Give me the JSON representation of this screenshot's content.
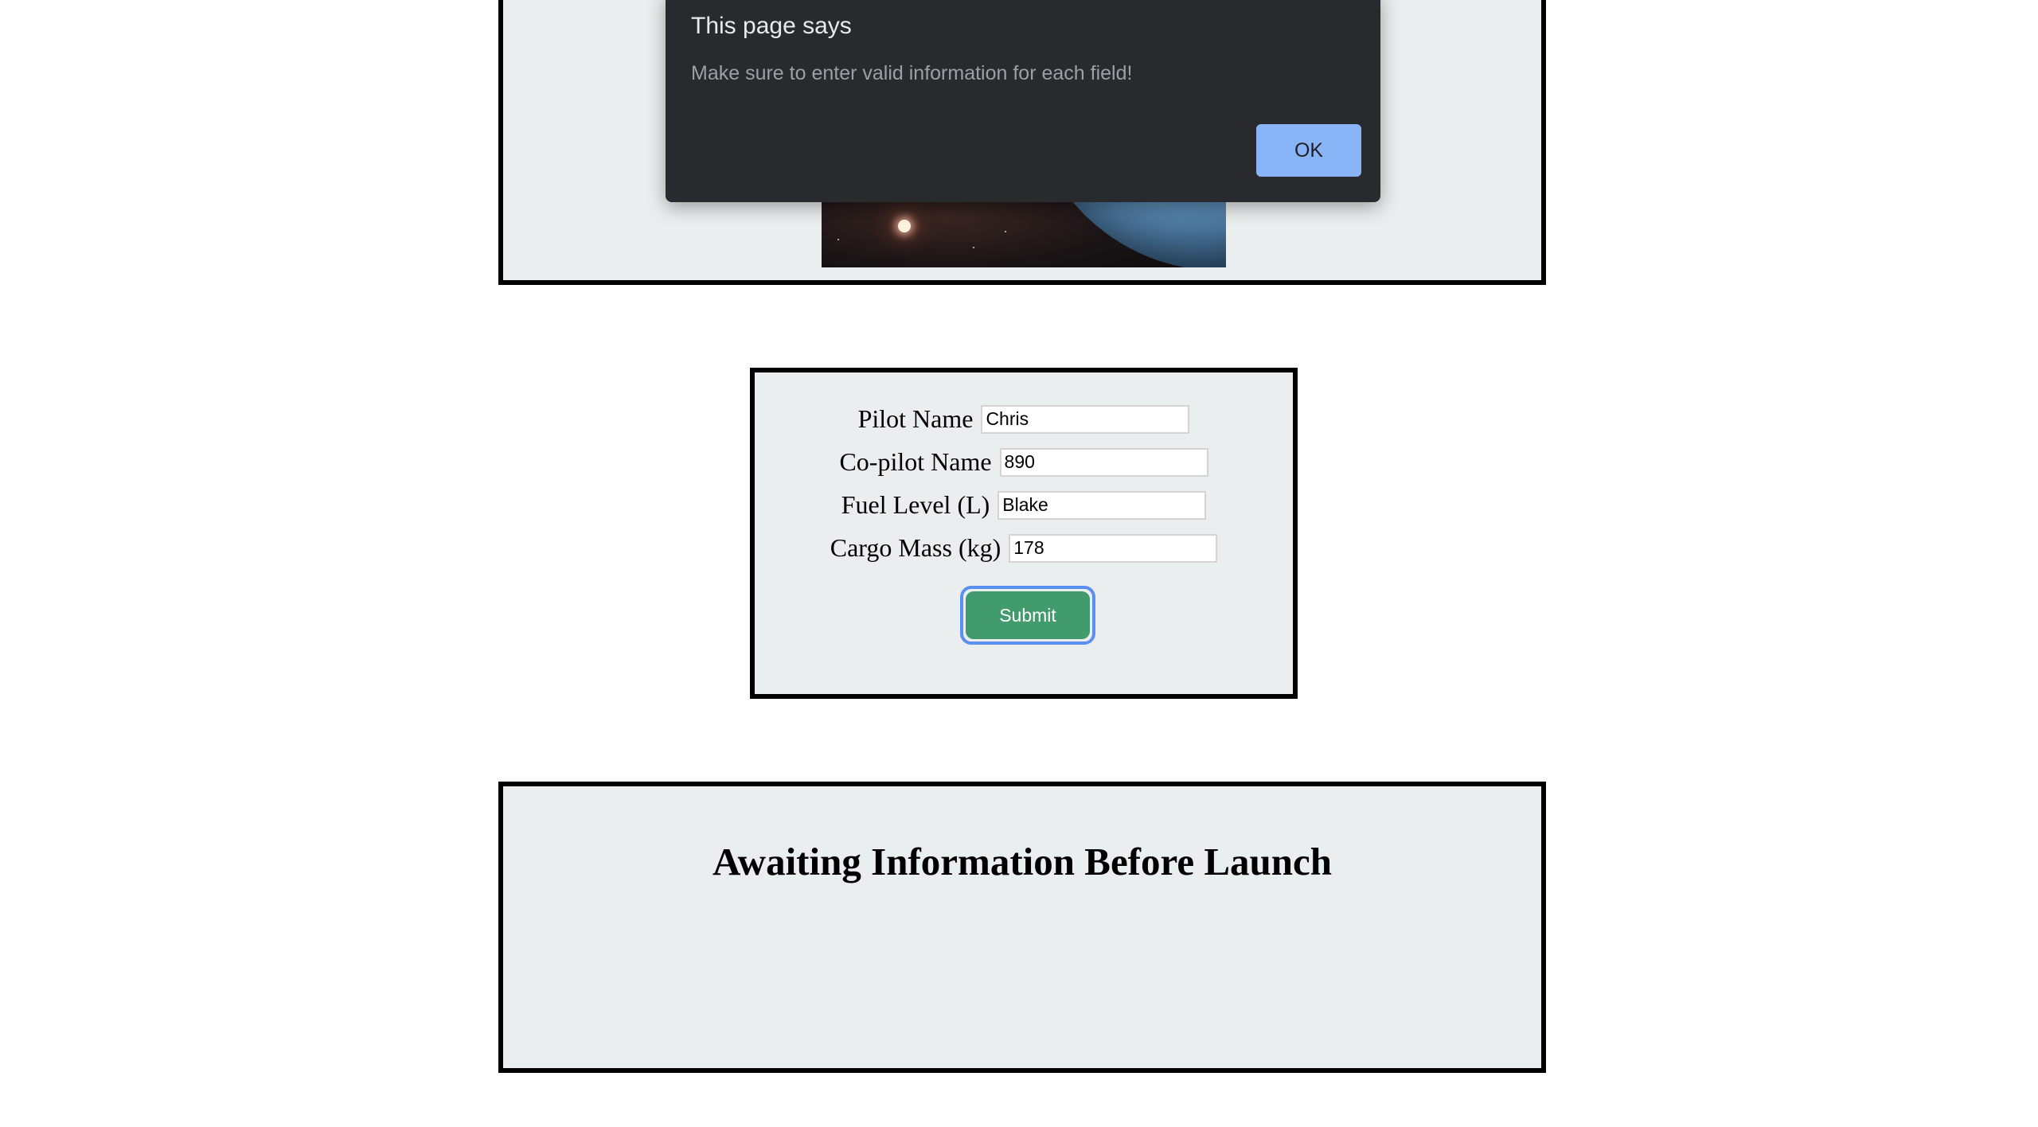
{
  "dialog": {
    "title": "This page says",
    "message": "Make sure to enter valid information for each field!",
    "ok_label": "OK"
  },
  "form": {
    "pilot": {
      "label": "Pilot Name",
      "value": "Chris"
    },
    "copilot": {
      "label": "Co-pilot Name",
      "value": "890"
    },
    "fuel": {
      "label": "Fuel Level (L)",
      "value": "Blake"
    },
    "cargo": {
      "label": "Cargo Mass (kg)",
      "value": "178"
    },
    "submit_label": "Submit"
  },
  "launch_status": {
    "title": "Awaiting Information Before Launch"
  },
  "colors": {
    "panel_background": "#ebeeee",
    "submit_button": "#419b6c",
    "focus_ring": "#5b8ff0",
    "dialog_background": "#292a2d",
    "dialog_button": "#8ab4f8"
  }
}
